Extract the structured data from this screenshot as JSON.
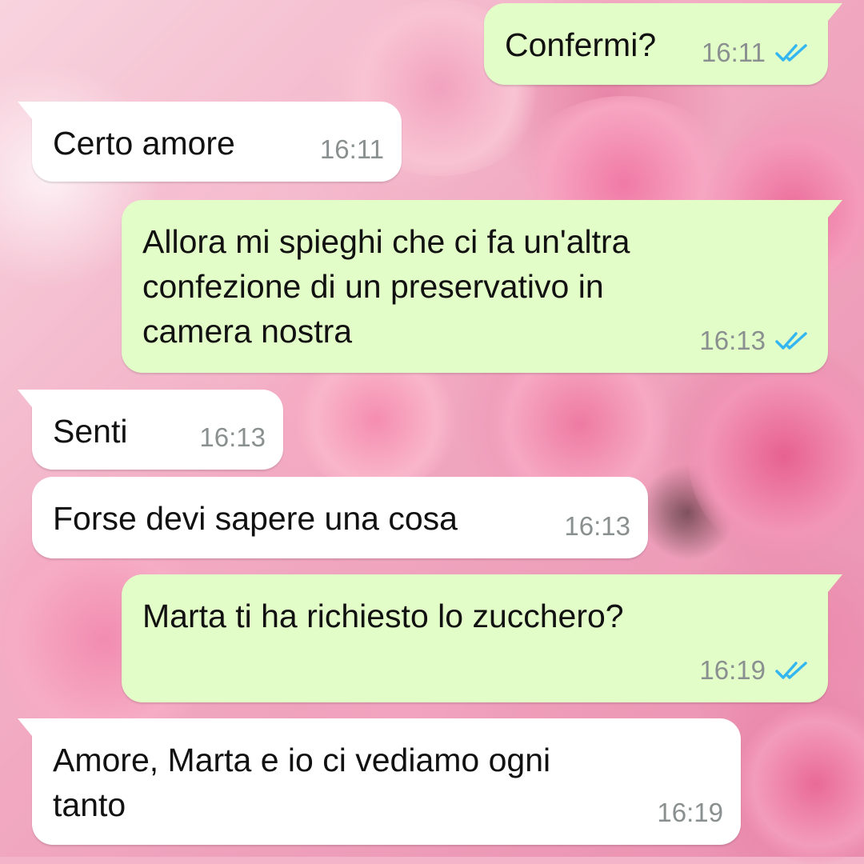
{
  "chat": {
    "messages": [
      {
        "direction": "outgoing",
        "text": "Confermi?",
        "time": "16:11",
        "status": "read"
      },
      {
        "direction": "incoming",
        "text": "Certo amore",
        "time": "16:11"
      },
      {
        "direction": "outgoing",
        "text": "Allora mi spieghi che ci fa un'altra\nconfezione di un preservativo in\ncamera nostra",
        "time": "16:13",
        "status": "read"
      },
      {
        "direction": "incoming",
        "text": "Senti",
        "time": "16:13"
      },
      {
        "direction": "incoming",
        "text": "Forse devi sapere una cosa",
        "time": "16:13"
      },
      {
        "direction": "outgoing",
        "text": "Marta ti ha richiesto lo zucchero?",
        "time": "16:19",
        "status": "read"
      },
      {
        "direction": "incoming",
        "text": "Amore, Marta e io ci vediamo ogni\ntanto",
        "time": "16:19"
      }
    ]
  },
  "colors": {
    "outgoing_bubble": "#e3fdc8",
    "incoming_bubble": "#ffffff",
    "read_ticks": "#34b7f1",
    "timestamp": "#8a8f8f"
  },
  "icons": {
    "read_receipt": "double-check-icon"
  }
}
